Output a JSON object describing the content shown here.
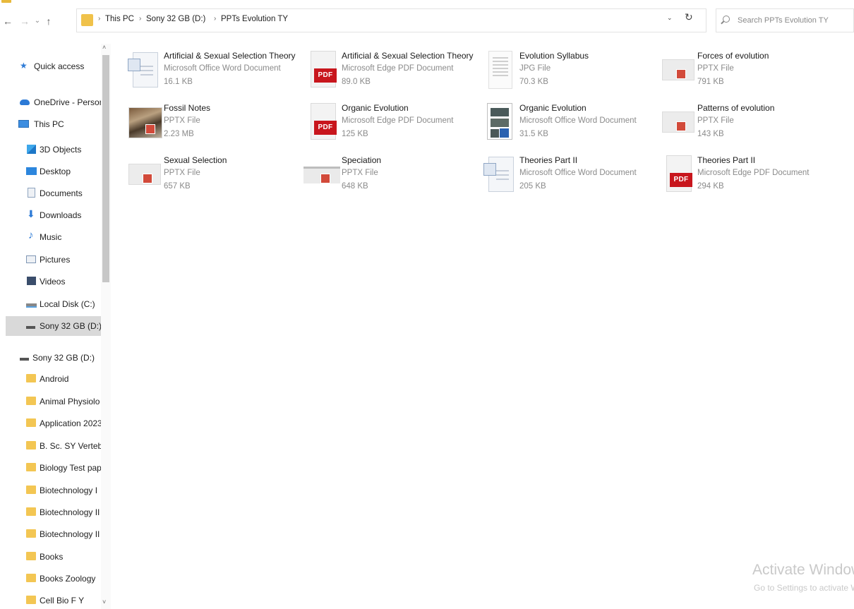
{
  "toolbar": {
    "back": "←",
    "forward": "→",
    "recent": "⌄",
    "up": "↑"
  },
  "address": {
    "separator": "›",
    "crumbs": [
      "This PC",
      "Sony 32 GB (D:)",
      "PPTs Evolution TY"
    ],
    "dropdown": "⌄",
    "refresh": "↻"
  },
  "search": {
    "placeholder": "Search PPTs Evolution TY"
  },
  "nav": {
    "scroll_up": "˄",
    "scroll_down": "˅",
    "items": [
      {
        "label": "Quick access",
        "icon": "star-icon"
      },
      {
        "label": "OneDrive - Person",
        "icon": "cloud-icon"
      },
      {
        "label": "This PC",
        "icon": "computer-icon"
      },
      {
        "label": "3D Objects",
        "icon": "cube-icon"
      },
      {
        "label": "Desktop",
        "icon": "desktop-icon"
      },
      {
        "label": "Documents",
        "icon": "documents-icon"
      },
      {
        "label": "Downloads",
        "icon": "download-arrow-icon"
      },
      {
        "label": "Music",
        "icon": "music-note-icon"
      },
      {
        "label": "Pictures",
        "icon": "pictures-icon"
      },
      {
        "label": "Videos",
        "icon": "videos-icon"
      },
      {
        "label": "Local Disk (C:)",
        "icon": "disk-drive-icon"
      },
      {
        "label": "Sony 32 GB (D:)",
        "icon": "usb-drive-icon"
      },
      {
        "label": "Sony 32 GB (D:)",
        "icon": "usb-drive-icon"
      },
      {
        "label": "Android",
        "icon": "folder-icon"
      },
      {
        "label": "Animal Physiolo",
        "icon": "folder-icon"
      },
      {
        "label": "Application 2023",
        "icon": "folder-icon"
      },
      {
        "label": "B. Sc. SY Vertebr",
        "icon": "folder-icon"
      },
      {
        "label": "Biology Test pap",
        "icon": "folder-icon"
      },
      {
        "label": "Biotechnology I",
        "icon": "folder-icon"
      },
      {
        "label": "Biotechnology II",
        "icon": "folder-icon"
      },
      {
        "label": "Biotechnology II",
        "icon": "folder-icon"
      },
      {
        "label": "Books",
        "icon": "folder-icon"
      },
      {
        "label": "Books Zoology",
        "icon": "folder-icon"
      },
      {
        "label": "Cell Bio F Y",
        "icon": "folder-icon"
      }
    ]
  },
  "files": [
    {
      "name": "Artificial & Sexual Selection Theory",
      "type": "Microsoft Office Word Document",
      "size": "16.1 KB",
      "icon": "word-document-icon"
    },
    {
      "name": "Artificial & Sexual Selection Theory",
      "type": "Microsoft Edge PDF Document",
      "size": "89.0 KB",
      "icon": "pdf-icon",
      "badge": "PDF"
    },
    {
      "name": "Evolution Syllabus",
      "type": "JPG File",
      "size": "70.3 KB",
      "icon": "image-file-icon"
    },
    {
      "name": "Forces of evolution",
      "type": "PPTX File",
      "size": "791 KB",
      "icon": "powerpoint-file-icon"
    },
    {
      "name": "Fossil Notes",
      "type": "PPTX File",
      "size": "2.23 MB",
      "icon": "powerpoint-photo-icon"
    },
    {
      "name": "Organic Evolution",
      "type": "Microsoft Edge PDF Document",
      "size": "125 KB",
      "icon": "pdf-icon",
      "badge": "PDF"
    },
    {
      "name": "Organic Evolution",
      "type": "Microsoft Office Word Document",
      "size": "31.5 KB",
      "icon": "word-document-icon"
    },
    {
      "name": "Patterns of evolution",
      "type": "PPTX File",
      "size": "143 KB",
      "icon": "powerpoint-file-icon"
    },
    {
      "name": "Sexual Selection",
      "type": "PPTX File",
      "size": "657 KB",
      "icon": "powerpoint-file-icon"
    },
    {
      "name": "Speciation",
      "type": "PPTX File",
      "size": "648 KB",
      "icon": "powerpoint-file-icon"
    },
    {
      "name": "Theories Part II",
      "type": "Microsoft Office Word Document",
      "size": "205 KB",
      "icon": "word-document-icon"
    },
    {
      "name": "Theories Part II",
      "type": "Microsoft Edge PDF Document",
      "size": "294 KB",
      "icon": "pdf-icon",
      "badge": "PDF"
    }
  ],
  "watermark": {
    "line1": "Activate Windows",
    "line2": "Go to Settings to activate Windows."
  },
  "colors": {
    "pdf_badge": "#c8161d",
    "folder": "#f3c653",
    "selected_row": "#d9d9d9",
    "accent_blue": "#2c7ad6"
  }
}
